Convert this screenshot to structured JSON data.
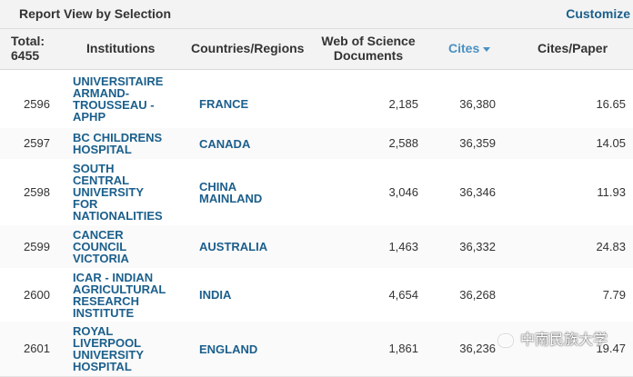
{
  "topbar": {
    "title": "Report View by Selection",
    "customize": "Customize"
  },
  "header": {
    "total_label": "Total:",
    "total_value": "6455",
    "institutions": "Institutions",
    "countries": "Countries/Regions",
    "wos_line1": "Web of Science",
    "wos_line2": "Documents",
    "cites": "Cites",
    "cites_per_paper": "Cites/Paper"
  },
  "rows": [
    {
      "rank": "2596",
      "inst": [
        "UNIVERSITAIRE",
        "ARMAND-",
        "TROUSSEAU -",
        "APHP"
      ],
      "country": [
        "FRANCE"
      ],
      "wos": "2,185",
      "cites": "36,380",
      "cpp": "16.65"
    },
    {
      "rank": "2597",
      "inst": [
        "BC CHILDRENS",
        "HOSPITAL"
      ],
      "country": [
        "CANADA"
      ],
      "wos": "2,588",
      "cites": "36,359",
      "cpp": "14.05"
    },
    {
      "rank": "2598",
      "inst": [
        "SOUTH",
        "CENTRAL",
        "UNIVERSITY",
        "FOR",
        "NATIONALITIES"
      ],
      "country": [
        "CHINA",
        "MAINLAND"
      ],
      "wos": "3,046",
      "cites": "36,346",
      "cpp": "11.93"
    },
    {
      "rank": "2599",
      "inst": [
        "CANCER",
        "COUNCIL",
        "VICTORIA"
      ],
      "country": [
        "AUSTRALIA"
      ],
      "wos": "1,463",
      "cites": "36,332",
      "cpp": "24.83"
    },
    {
      "rank": "2600",
      "inst": [
        "ICAR - INDIAN",
        "AGRICULTURAL",
        "RESEARCH",
        "INSTITUTE"
      ],
      "country": [
        "INDIA"
      ],
      "wos": "4,654",
      "cites": "36,268",
      "cpp": "7.79"
    },
    {
      "rank": "2601",
      "inst": [
        "ROYAL",
        "LIVERPOOL",
        "UNIVERSITY",
        "HOSPITAL"
      ],
      "country": [
        "ENGLAND"
      ],
      "wos": "1,861",
      "cites": "36,236",
      "cpp": "19.47"
    }
  ],
  "watermark": "中南民族大学",
  "colors": {
    "link": "#1b5f8c",
    "sorted_header": "#4a90c2",
    "header_bg": "#f3f3f3"
  }
}
